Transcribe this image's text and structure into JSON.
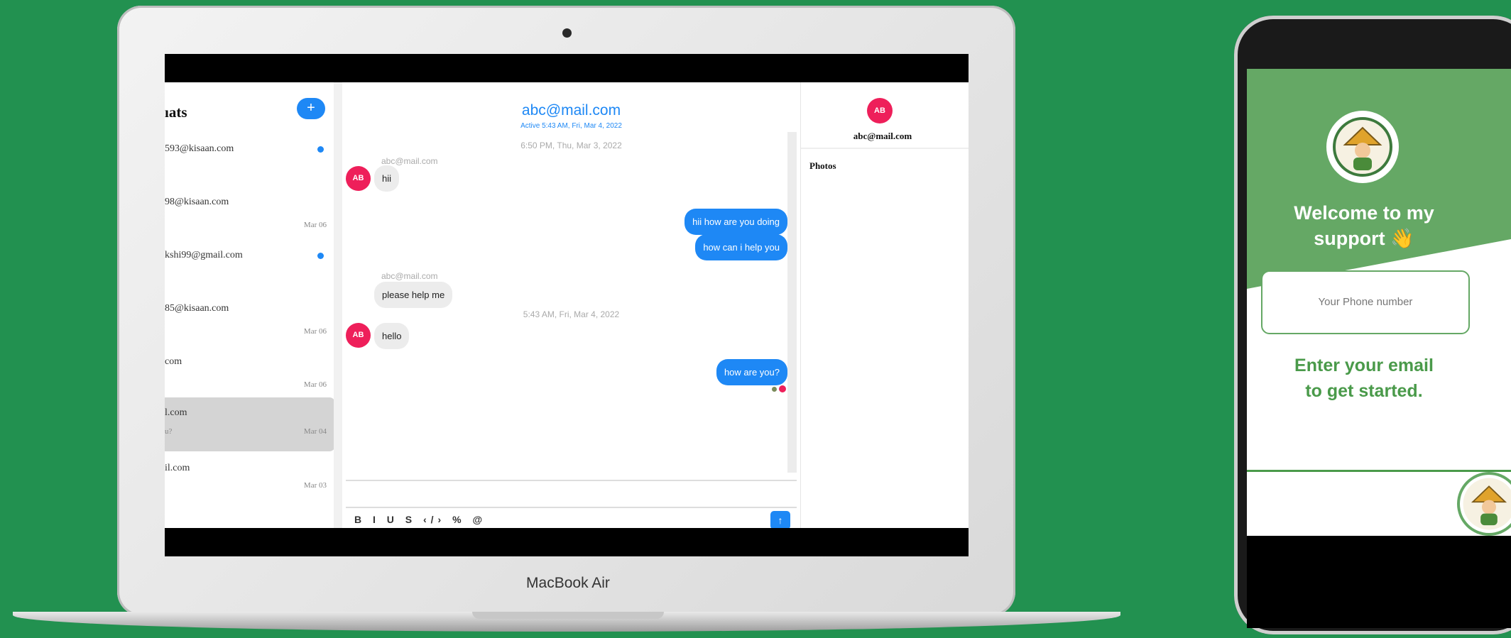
{
  "laptop": {
    "brand": "MacBook Air"
  },
  "sidebar": {
    "title": "ıats",
    "new_chat_label": "+",
    "conversations": [
      {
        "name": "593@kisaan.com",
        "sub": "",
        "date": "",
        "unread": true
      },
      {
        "name": "98@kisaan.com",
        "sub": "",
        "date": "Mar 06",
        "unread": false
      },
      {
        "name": "kshi99@gmail.com",
        "sub": "",
        "date": "",
        "unread": true
      },
      {
        "name": "85@kisaan.com",
        "sub": "",
        "date": "Mar 06",
        "unread": false
      },
      {
        "name": "com",
        "sub": "",
        "date": "Mar 06",
        "unread": false
      },
      {
        "name": "l.com",
        "sub": "u?",
        "date": "Mar 04",
        "unread": false,
        "active": true
      },
      {
        "name": "il.com",
        "sub": "",
        "date": "Mar 03",
        "unread": false
      }
    ]
  },
  "conversation": {
    "title": "abc@mail.com",
    "status": "Active 5:43 AM, Fri, Mar 4, 2022",
    "timestamps": [
      "6:50 PM, Thu, Mar 3, 2022",
      "5:43 AM, Fri, Mar 4, 2022"
    ],
    "avatar_initials": "AB",
    "sender": "abc@mail.com",
    "messages_in": [
      "hii",
      "please help me",
      "hello"
    ],
    "messages_out": [
      "hii how are you doing",
      "how can i help you",
      "how are you?"
    ],
    "send_label": "↑",
    "toolbar_label": "B I U S ‹/› % @"
  },
  "info": {
    "avatar_initials": "AB",
    "email": "abc@mail.com",
    "photos_label": "Photos"
  },
  "phone": {
    "welcome_line1": "Welcome to my",
    "welcome_line2": "support 👋",
    "input_placeholder": "Your Phone number",
    "cta_line1": "Enter your email",
    "cta_line2": "to get started."
  },
  "colors": {
    "background": "#229150",
    "accent": "#1e88f5",
    "avatar": "#ee1f5a",
    "brand_green": "#65a865"
  }
}
